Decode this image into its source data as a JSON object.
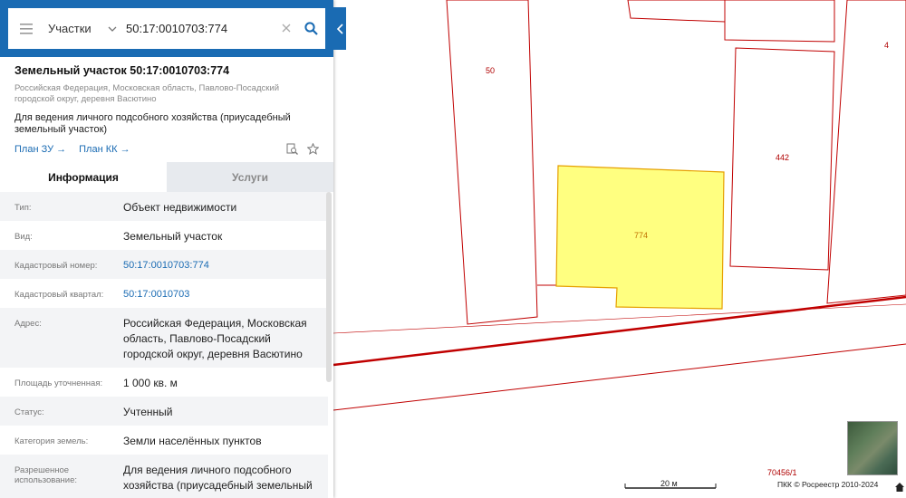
{
  "search": {
    "category": "Участки",
    "query": "50:17:0010703:774"
  },
  "object": {
    "title": "Земельный участок 50:17:0010703:774",
    "address": "Российская Федерация, Московская область, Павлово-Посадский городской округ, деревня Васютино",
    "use": "Для ведения личного подсобного хозяйства (приусадебный земельный участок)",
    "links": [
      "План ЗУ →",
      "План КК →"
    ]
  },
  "tabs": {
    "info": "Информация",
    "services": "Услуги"
  },
  "info_rows": [
    {
      "key": "Тип:",
      "value": "Объект недвижимости"
    },
    {
      "key": "Вид:",
      "value": "Земельный участок"
    },
    {
      "key": "Кадастровый номер:",
      "value": "50:17:0010703:774"
    },
    {
      "key": "Кадастровый квартал:",
      "value": "50:17:0010703"
    },
    {
      "key": "Адрес:",
      "value": "Российская Федерация, Московская область, Павлово-Посадский городской округ, деревня Васютино"
    },
    {
      "key": "Площадь уточненная:",
      "value": "1 000 кв. м"
    },
    {
      "key": "Статус:",
      "value": "Учтенный"
    },
    {
      "key": "Категория земель:",
      "value": "Земли населённых пунктов"
    },
    {
      "key": "Разрешенное использование:",
      "value": "Для ведения личного подсобного хозяйства (приусадебный земельный"
    }
  ],
  "map": {
    "labels": {
      "p50": "50",
      "p774": "774",
      "p442": "442",
      "p4": "4",
      "p70456": "70456/1"
    },
    "scale_label": "20 м",
    "copyright": "ПКК © Росреестр 2010-2024",
    "colors": {
      "boundary": "#c00000",
      "selected_fill": "#ffff80",
      "selected_stroke": "#e6a000",
      "header": "#1a6bb3"
    }
  }
}
